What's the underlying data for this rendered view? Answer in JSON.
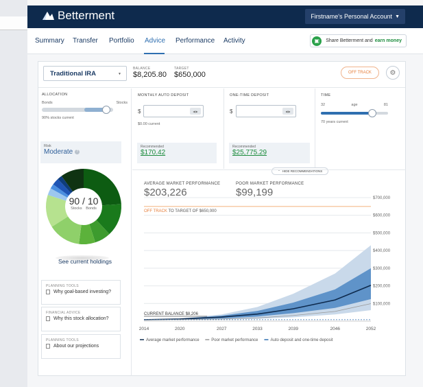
{
  "app": {
    "brand": "Betterment",
    "account_menu": "Firstname's Personal Account"
  },
  "nav": {
    "items": [
      "Summary",
      "Transfer",
      "Portfolio",
      "Advice",
      "Performance",
      "Activity"
    ],
    "active": "Advice",
    "share_prefix": "Share Betterment and",
    "share_highlight": "earn money"
  },
  "goal": {
    "account": "Traditional IRA",
    "balance_label": "BALANCE",
    "balance": "$8,205.80",
    "target_label": "TARGET",
    "target": "$650,000",
    "status_button": "OFF TRACK"
  },
  "allocation": {
    "title": "ALLOCATION",
    "left": "Bonds",
    "right": "Stocks",
    "current": "90% stocks current",
    "stocks_fraction": 0.9,
    "risk_label": "Risk",
    "risk_value": "Moderate"
  },
  "monthly": {
    "title": "MONTHLY AUTO DEPOSIT",
    "current": "$0.00 current",
    "reco_label": "Recommended",
    "reco_value": "$170.42"
  },
  "onetime": {
    "title": "ONE-TIME DEPOSIT",
    "reco_label": "Recommended",
    "reco_value": "$25,775.29"
  },
  "time": {
    "title": "TIME",
    "min": "32",
    "mid": "age",
    "max": "81",
    "current": "70 years current",
    "age_fraction": 0.77
  },
  "hide_recommendations": "HIDE RECOMMENDATIONS",
  "donut": {
    "center": "90 / 10",
    "sub_left": "Stocks",
    "sub_right": "Bonds",
    "slices": [
      {
        "color": "#0d5c12",
        "value": 24
      },
      {
        "color": "#1a7a1c",
        "value": 14
      },
      {
        "color": "#3d9b2e",
        "value": 7
      },
      {
        "color": "#5cb23b",
        "value": 7
      },
      {
        "color": "#8fd06a",
        "value": 14
      },
      {
        "color": "#b6e28f",
        "value": 14
      },
      {
        "color": "#9cc7ef",
        "value": 3
      },
      {
        "color": "#4b8fe0",
        "value": 2
      },
      {
        "color": "#1f55b5",
        "value": 3
      },
      {
        "color": "#0e3d7c",
        "value": 2
      },
      {
        "color": "#0f3312",
        "value": 10
      }
    ]
  },
  "holdings_link": "See current holdings",
  "tools": [
    {
      "kind": "PLANNING TOOLS",
      "label": "Why goal-based investing?"
    },
    {
      "kind": "FINANCIAL ADVICE",
      "label": "Why this stock allocation?"
    },
    {
      "kind": "PLANNING TOOLS",
      "label": "About our projections"
    }
  ],
  "projection": {
    "avg_label": "AVERAGE MARKET PERFORMANCE",
    "avg_value": "$203,226",
    "poor_label": "POOR MARKET PERFORMANCE",
    "poor_value": "$99,199",
    "offtrack_word": "OFF TRACK",
    "offtrack_rest": " TO TARGET OF $650,000",
    "current_balance": "CURRENT BALANCE $8,206"
  },
  "chart_data": {
    "type": "area",
    "x": [
      2014,
      2020,
      2027,
      2033,
      2039,
      2046,
      2052
    ],
    "x_tick_labels": [
      "2014",
      "2020",
      "2027",
      "2033",
      "2039",
      "2046",
      "2052"
    ],
    "y_tick_labels": [
      "$100,000",
      "$200,000",
      "$300,000",
      "$400,000",
      "$500,000",
      "$600,000",
      "$700,000"
    ],
    "y_ticks": [
      100000,
      200000,
      300000,
      400000,
      500000,
      600000,
      700000
    ],
    "ylim": [
      0,
      700000
    ],
    "target": 650000,
    "series": [
      {
        "name": "Average market performance",
        "color": "#0e2a4d",
        "values": [
          8206,
          12000,
          23000,
          40000,
          70000,
          120000,
          203226
        ]
      },
      {
        "name": "Poor market performance",
        "color": "#999999",
        "values": [
          8206,
          9000,
          12000,
          18000,
          32000,
          55000,
          99199
        ]
      },
      {
        "name": "Auto deposit and one-time deposit",
        "color": "#2f6fb0",
        "values": [
          8206,
          8206,
          8206,
          8206,
          8206,
          8206,
          8206
        ]
      }
    ],
    "bands": [
      {
        "color": "#c9d9ea",
        "upper": [
          8206,
          15000,
          38000,
          80000,
          155000,
          270000,
          430000
        ],
        "lower": [
          8206,
          7500,
          9000,
          13000,
          22000,
          38000,
          62000
        ]
      },
      {
        "color": "#5f93c9",
        "upper": [
          8206,
          13500,
          31000,
          58000,
          105000,
          180000,
          300000
        ],
        "lower": [
          8206,
          9500,
          15000,
          26000,
          45000,
          75000,
          125000
        ]
      }
    ]
  }
}
